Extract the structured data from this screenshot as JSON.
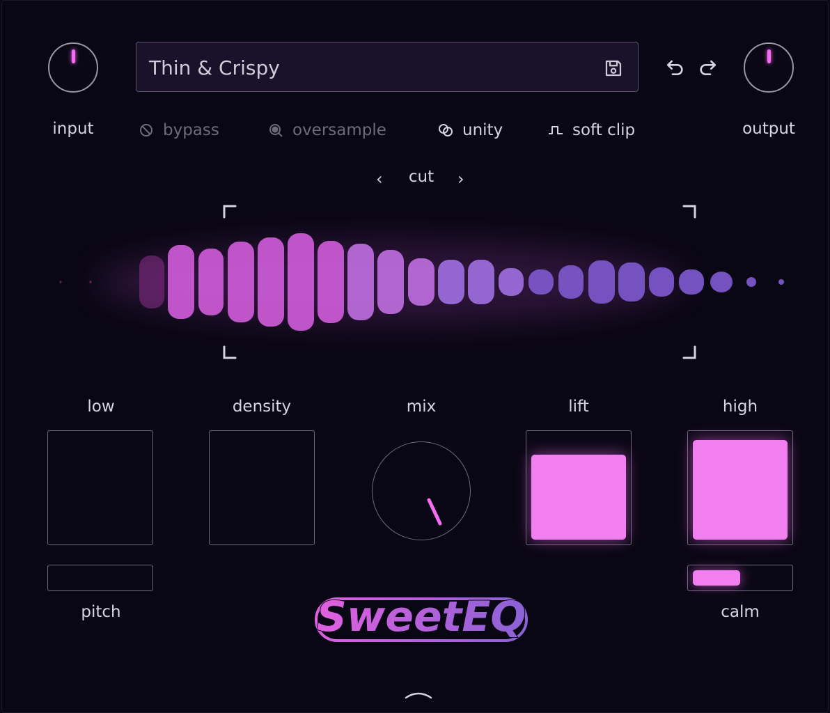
{
  "header": {
    "preset_name": "Thin & Crispy",
    "input_label": "input",
    "output_label": "output"
  },
  "toggles": {
    "bypass": "bypass",
    "oversample": "oversample",
    "unity": "unity",
    "soft_clip": "soft clip"
  },
  "mode": {
    "label": "cut",
    "prev": "‹",
    "next": "›"
  },
  "controls": {
    "low": "low",
    "density": "density",
    "mix": "mix",
    "lift": "lift",
    "high": "high",
    "pitch": "pitch",
    "calm": "calm"
  },
  "levels": {
    "low": 0.0,
    "density": 0.0,
    "lift": 0.82,
    "high": 0.96,
    "pitch": 0.0,
    "calm": 0.5
  },
  "logo_text": "SweetEQ",
  "colors": {
    "accent": "#f46cf0",
    "violet": "#8a62d6",
    "background": "#0a0714"
  },
  "icons": {
    "save": "save-icon",
    "undo": "undo-icon",
    "redo": "redo-icon",
    "bypass": "bypass-icon",
    "oversample": "oversample-icon",
    "unity": "unity-icon",
    "soft_clip": "soft-clip-icon"
  }
}
